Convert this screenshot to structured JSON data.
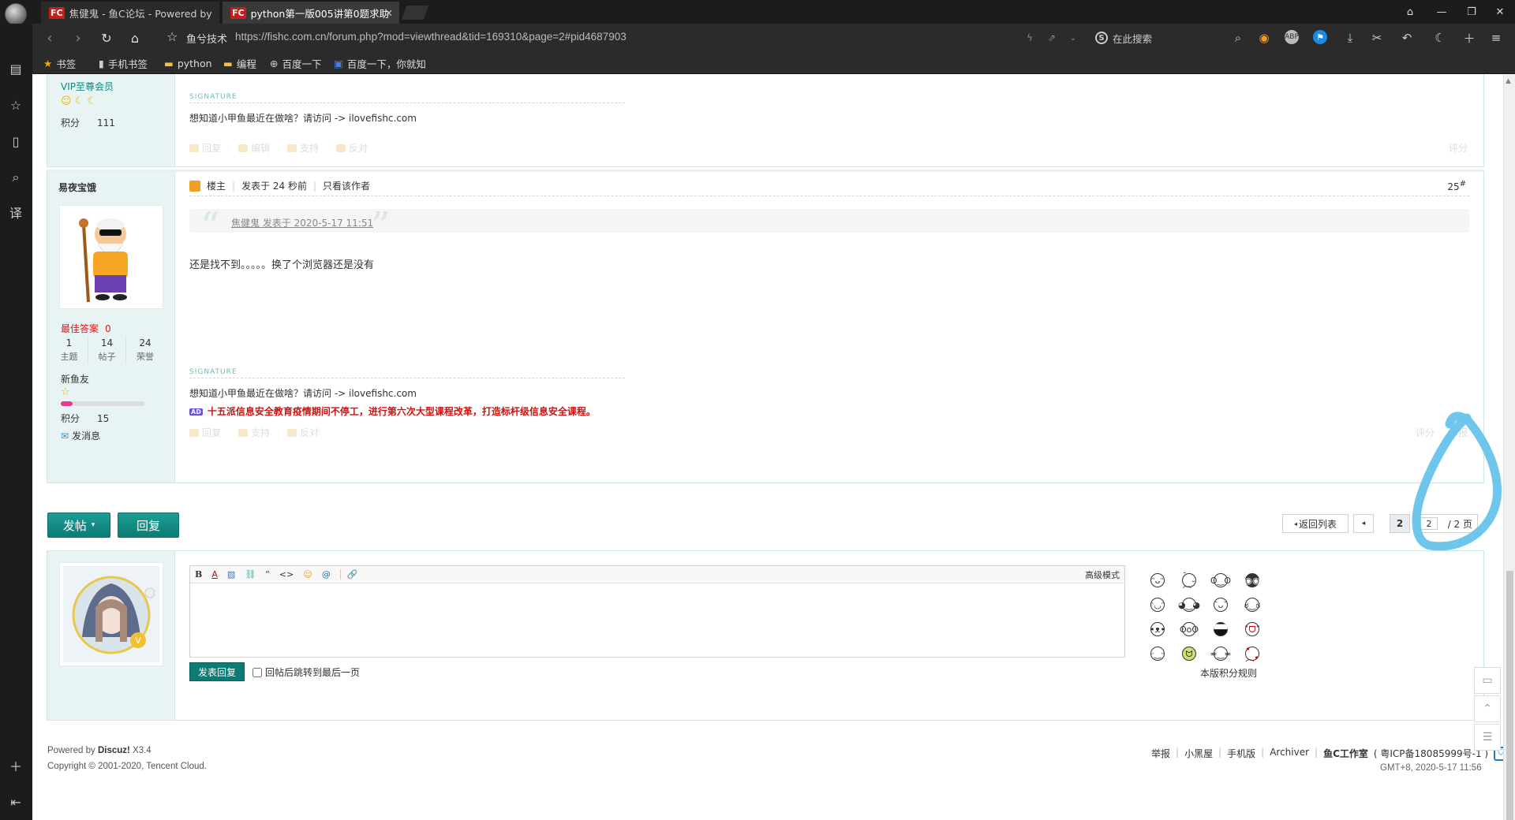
{
  "browser": {
    "tabs": [
      {
        "icon": "FC",
        "title": "焦健鬼 - 鱼C论坛 - Powered by"
      },
      {
        "icon": "FC",
        "title": "python第一版005讲第0题求助"
      }
    ],
    "address_prefix": "鱼兮技术",
    "url": "https://fishc.com.cn/forum.php?mod=viewthread&tid=169310&page=2#pid4687903",
    "search_placeholder": "在此搜索",
    "search_logo": "S",
    "bookmarks": [
      {
        "icon": "★",
        "label": "书签"
      },
      {
        "icon": "▮",
        "label": "手机书签"
      },
      {
        "icon": "▬",
        "label": "python"
      },
      {
        "icon": "▬",
        "label": "编程"
      },
      {
        "icon": "⊕",
        "label": "百度一下"
      },
      {
        "icon": "▣",
        "label": "百度一下，你就知"
      }
    ]
  },
  "prev_post": {
    "rank": "VIP至尊会员",
    "points_label": "积分",
    "points": "111",
    "signature_label": "SIGNATURE",
    "signature": "想知道小甲鱼最近在做啥？请访问 -> ilovefishc.com",
    "actions": [
      "回复",
      "编辑",
      "支持",
      "反对"
    ],
    "rate": "评分"
  },
  "post": {
    "username": "易夜宝饿",
    "best_answer_label": "最佳答案",
    "best_answer": "0",
    "stats": [
      {
        "value": "1",
        "label": "主题"
      },
      {
        "value": "14",
        "label": "帖子"
      },
      {
        "value": "24",
        "label": "荣誉"
      }
    ],
    "level": "新鱼友",
    "points_label": "积分",
    "points": "15",
    "message_link": "发消息",
    "op_label": "楼主",
    "posted": "发表于 24 秒前",
    "only_author": "只看该作者",
    "floor": "25",
    "floor_suffix": "#",
    "quote": "焦健鬼 发表于 2020-5-17 11:51",
    "body": "还是找不到。。。。。换了个浏览器还是没有",
    "signature_label": "SIGNATURE",
    "signature": "想知道小甲鱼最近在做啥？请访问 -> ilovefishc.com",
    "ad_badge": "AD",
    "ad": "十五派信息安全教育疫情期间不停工，进行第六次大型课程改革，打造标杆级信息安全课程。",
    "actions": [
      "回复",
      "支持",
      "反对"
    ],
    "rate": "评分",
    "report": "举报"
  },
  "controls": {
    "new_post": "发帖",
    "reply": "回复",
    "back_to_list": "返回列表",
    "current_page": "2",
    "page_input": "2",
    "total_pages": "/ 2 页"
  },
  "editor": {
    "toolbar": [
      "B",
      "A",
      "▨",
      "⛓",
      "“",
      "<>",
      "☺",
      "@",
      "🔗"
    ],
    "advanced_mode": "高级模式",
    "submit": "发表回复",
    "jump_last": "回帖后跳转到最后一页",
    "credit_rules": "本版积分规则"
  },
  "footer": {
    "powered_prefix": "Powered by ",
    "powered_brand": "Discuz!",
    "powered_version": " X3.4",
    "copyright": "Copyright © 2001-2020, Tencent Cloud.",
    "links": [
      "举报",
      "小黑屋",
      "手机版",
      "Archiver",
      "鱼C工作室",
      "( 粤ICP备18085999号-1 )"
    ],
    "time": "GMT+8, 2020-5-17 11:56"
  },
  "colors": {
    "accent": "#0c7c74",
    "annotation": "#6ec6ec",
    "ad": "#d01010"
  }
}
